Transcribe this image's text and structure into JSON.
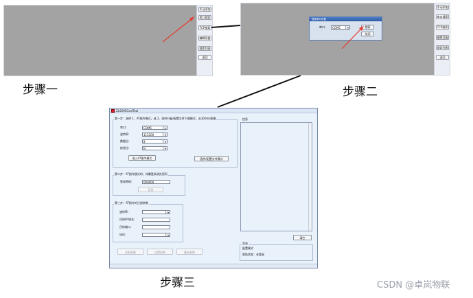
{
  "step_labels": {
    "step1": "步骤一",
    "step2": "步骤二",
    "step3": "步骤三"
  },
  "sidebar_buttons": [
    "手动添加",
    "串口搜索",
    "TCP搜索",
    "编辑设备",
    "搜索列表",
    "返回"
  ],
  "step2_dialog": {
    "title": "搜索串口设备",
    "port_label": "串口:",
    "port_value": "COM5",
    "ok_label": "搜索",
    "cancel_label": "关闭"
  },
  "tool": {
    "title": "ZLSX95ConfTool",
    "step1": {
      "heading": "第一步：选择 1、AT指令模式，或 2、固件升级/配置文件下载模式，出300ms图像",
      "labels": [
        "串口:",
        "波特率:",
        "数据位:",
        "校验位:"
      ],
      "values": [
        "COM5",
        "115200",
        "8",
        "N"
      ],
      "at_button": "进入AT指令模式",
      "fw_button": "固件/配置文件模式"
    },
    "step2": {
      "heading": "第二步：AT指令模式时，如需登录请先密码",
      "password_label": "登录密码:",
      "password_value": "000000",
      "login_button": "登录"
    },
    "step3": {
      "heading": "第三步：AT指令的注册参数",
      "labels": [
        "波特率:",
        "目的IP/域名:",
        "目的端口:",
        "协议:"
      ]
    },
    "bottom_buttons": [
      "读取参数",
      "设置参数",
      "重启参数"
    ],
    "info_label": "信息",
    "clear_button": "清空",
    "status": {
      "label": "状态",
      "mode": "配置模式",
      "login_status": "登陆状态：未登录"
    }
  },
  "watermark": "CSDN @卓岚物联",
  "colors": {
    "arrow": "#e8392f",
    "gray_panel": "#a3a3a3",
    "window_bg": "#e9f1fb"
  }
}
